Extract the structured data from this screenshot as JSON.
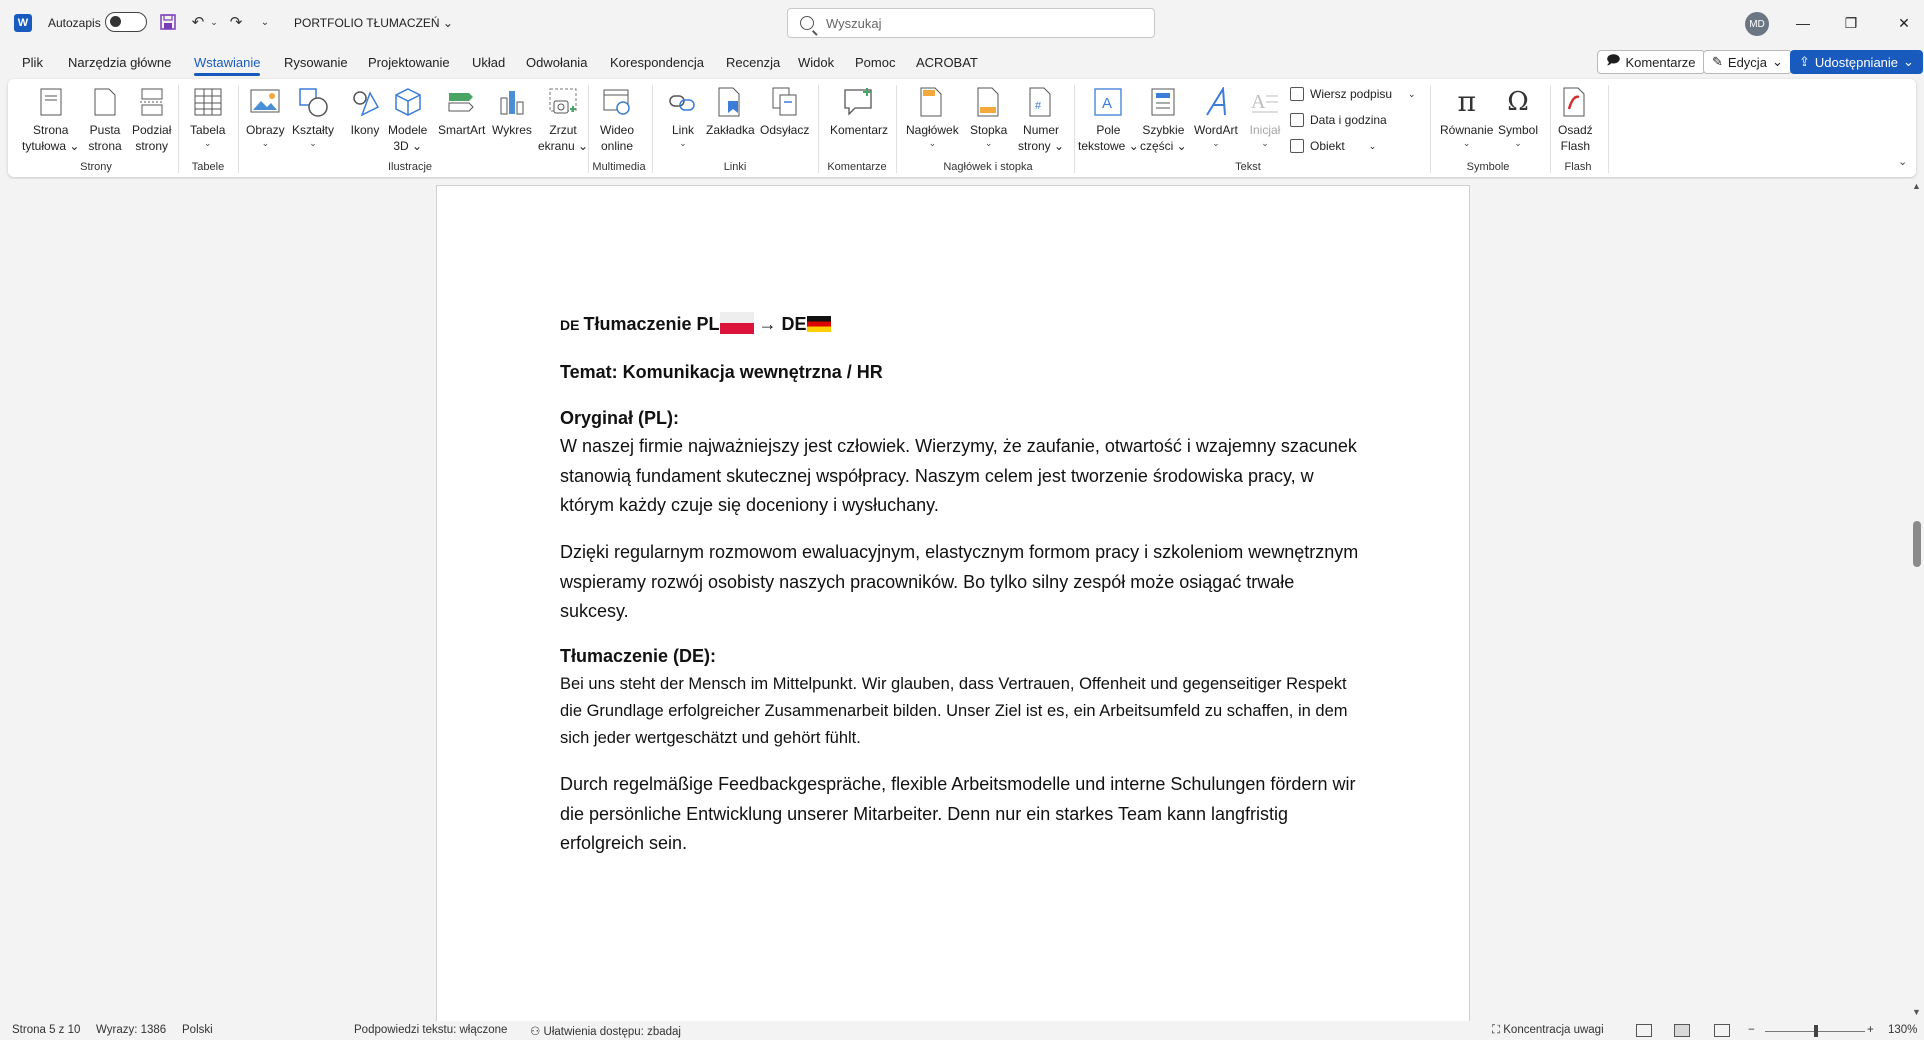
{
  "titlebar": {
    "autosave_label": "Autozapis",
    "doc_title": "PORTFOLIO TŁUMACZEŃ",
    "search_placeholder": "Wyszukaj",
    "user_initials": "MD"
  },
  "menu": {
    "tabs": [
      "Plik",
      "Narzędzia główne",
      "Wstawianie",
      "Rysowanie",
      "Projektowanie",
      "Układ",
      "Odwołania",
      "Korespondencja",
      "Recenzja",
      "Widok",
      "Pomoc",
      "ACROBAT"
    ],
    "active_tab": "Wstawianie",
    "comments_button": "Komentarze",
    "editing_button": "Edycja",
    "share_button": "Udostępnianie"
  },
  "ribbon": {
    "pages": {
      "cover": [
        "Strona",
        "tytułowa"
      ],
      "blank": [
        "Pusta",
        "strona"
      ],
      "break": [
        "Podział",
        "strony"
      ],
      "group": "Strony"
    },
    "tables": {
      "table": "Tabela",
      "group": "Tabele"
    },
    "illustrations": {
      "pictures": "Obrazy",
      "shapes": "Kształty",
      "icons": "Ikony",
      "models3d": [
        "Modele",
        "3D"
      ],
      "smartart": "SmartArt",
      "chart": "Wykres",
      "screenshot": [
        "Zrzut",
        "ekranu"
      ],
      "group": "Ilustracje"
    },
    "media": {
      "video": [
        "Wideo",
        "online"
      ],
      "group": "Multimedia"
    },
    "links": {
      "link": "Link",
      "bookmark": "Zakładka",
      "crossref": "Odsyłacz",
      "group": "Linki"
    },
    "comments": {
      "comment": "Komentarz",
      "group": "Komentarze"
    },
    "headerfooter": {
      "header": "Nagłówek",
      "footer": "Stopka",
      "pagenum": [
        "Numer",
        "strony"
      ],
      "group": "Nagłówek i stopka"
    },
    "text": {
      "textbox": [
        "Pole",
        "tekstowe"
      ],
      "quickparts": [
        "Szybkie",
        "części"
      ],
      "wordart": "WordArt",
      "dropcap": "Inicjał",
      "signature": "Wiersz podpisu",
      "datetime": "Data i godzina",
      "object": "Obiekt",
      "group": "Tekst"
    },
    "symbols": {
      "equation": "Równanie",
      "symbol": "Symbol",
      "group": "Symbole"
    },
    "flash": {
      "embed": [
        "Osadź",
        "Flash"
      ],
      "group": "Flash"
    }
  },
  "document": {
    "heading_tag": "DE",
    "heading_text": "Tłumaczenie PL",
    "heading_arrow": "→ DE",
    "topic": "Temat: Komunikacja wewnętrzna / HR",
    "original_label": "Oryginał (PL):",
    "original_p1": "W naszej firmie najważniejszy jest człowiek. Wierzymy, że zaufanie, otwartość i wzajemny szacunek stanowią fundament skutecznej współpracy. Naszym celem jest tworzenie środowiska pracy, w którym każdy czuje się doceniony i wysłuchany.",
    "original_p2": "Dzięki regularnym rozmowom ewaluacyjnym, elastycznym formom pracy i szkoleniom wewnętrznym wspieramy rozwój osobisty naszych pracowników. Bo tylko silny zespół może osiągać trwałe sukcesy.",
    "translation_label": "Tłumaczenie (DE):",
    "translation_p1": "Bei uns steht der Mensch im Mittelpunkt. Wir glauben, dass Vertrauen, Offenheit und gegenseitiger Respekt die Grundlage erfolgreicher Zusammenarbeit bilden. Unser Ziel ist es, ein Arbeitsumfeld zu schaffen, in dem sich jeder wertgeschätzt und gehört fühlt.",
    "translation_p2": "Durch regelmäßige Feedbackgespräche, flexible Arbeitsmodelle und interne Schulungen fördern wir die persönliche Entwicklung unserer Mitarbeiter. Denn nur ein starkes Team kann langfristig erfolgreich sein."
  },
  "statusbar": {
    "page": "Strona 5 z 10",
    "words": "Wyrazy: 1386",
    "language": "Polski",
    "predictions": "Podpowiedzi tekstu: włączone",
    "accessibility": "Ułatwienia dostępu: zbadaj",
    "focus": "Koncentracja uwagi",
    "zoom": "130%"
  },
  "colors": {
    "accent": "#185abd",
    "pl_red": "#dc143c",
    "de_gold": "#ffce00"
  }
}
